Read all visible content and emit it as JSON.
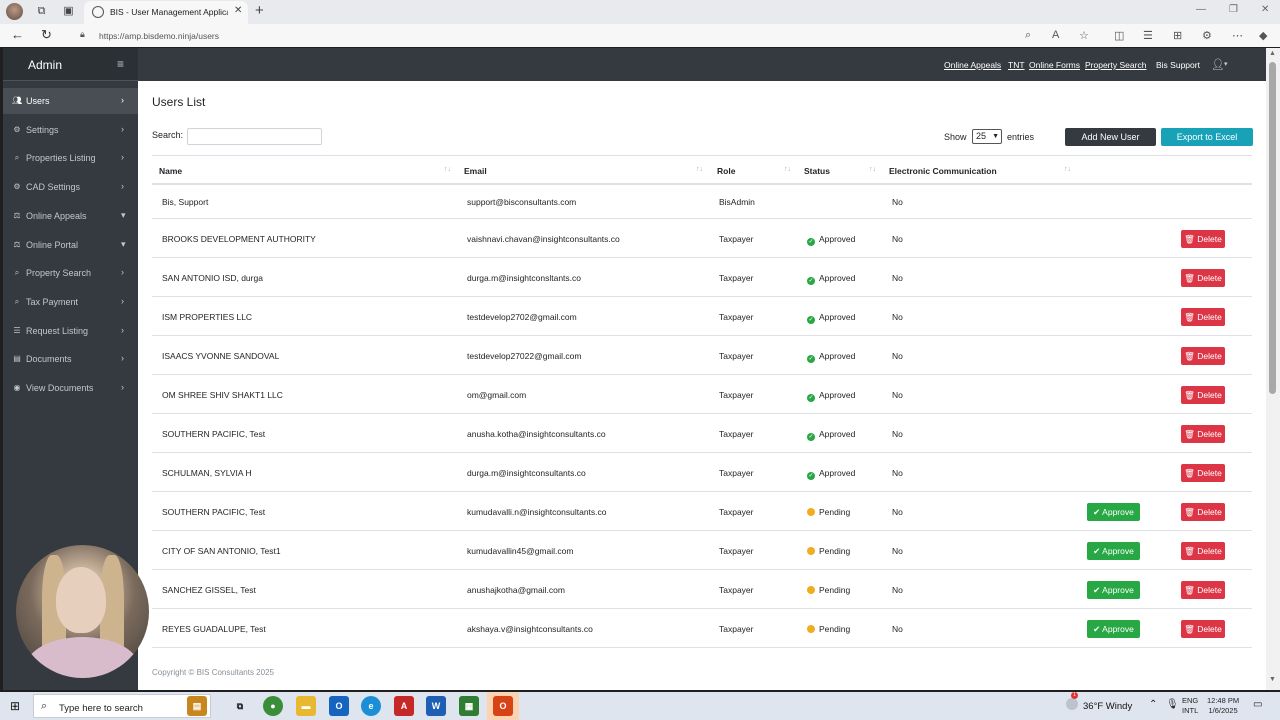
{
  "browser": {
    "tab_title": "BIS - User Management Applicati",
    "url": "https://amp.bisdemo.ninja/users"
  },
  "sidebar": {
    "brand": "Admin",
    "items": [
      {
        "label": "Users",
        "icon": "users-icon",
        "chevron": "›",
        "active": true
      },
      {
        "label": "Settings",
        "icon": "gear-icon",
        "chevron": "›"
      },
      {
        "label": "Properties Listing",
        "icon": "search-icon",
        "chevron": "›"
      },
      {
        "label": "CAD Settings",
        "icon": "gear-icon",
        "chevron": "›"
      },
      {
        "label": "Online Appeals",
        "icon": "gavel-icon",
        "chevron": "▾"
      },
      {
        "label": "Online Portal",
        "icon": "gavel-icon",
        "chevron": "▾"
      },
      {
        "label": "Property Search",
        "icon": "search-icon",
        "chevron": "›"
      },
      {
        "label": "Tax Payment",
        "icon": "search-icon",
        "chevron": "›"
      },
      {
        "label": "Request Listing",
        "icon": "list-icon",
        "chevron": "›"
      },
      {
        "label": "Documents",
        "icon": "file-icon",
        "chevron": "›"
      },
      {
        "label": "View Documents",
        "icon": "eye-icon",
        "chevron": "›"
      }
    ]
  },
  "topnav": {
    "links": [
      "Online Appeals",
      "TNT",
      "Online Forms",
      "Property Search"
    ],
    "user": "Bis Support"
  },
  "page": {
    "title": "Users List",
    "search_label": "Search:",
    "show_label": "Show",
    "page_size": "25",
    "entries_label": "entries",
    "add_button": "Add New User",
    "export_button": "Export to Excel",
    "footer": "Copyright © BIS Consultants 2025"
  },
  "table": {
    "columns": [
      "Name",
      "Email",
      "Role",
      "Status",
      "Electronic Communication"
    ],
    "delete_label": "Delete",
    "approve_label": "Approve",
    "rows": [
      {
        "name": "Bis, Support",
        "email": "support@bisconsultants.com",
        "role": "BisAdmin",
        "status": "",
        "ecomm": "No",
        "approve": false,
        "delete": false
      },
      {
        "name": "BROOKS DEVELOPMENT AUTHORITY",
        "email": "vaishnavi.chavan@insightconsultants.co",
        "role": "Taxpayer",
        "status": "Approved",
        "ecomm": "No",
        "approve": false,
        "delete": true
      },
      {
        "name": "SAN ANTONIO ISD, durga",
        "email": "durga.m@insightconsltants.co",
        "role": "Taxpayer",
        "status": "Approved",
        "ecomm": "No",
        "approve": false,
        "delete": true
      },
      {
        "name": "ISM PROPERTIES LLC",
        "email": "testdevelop2702@gmail.com",
        "role": "Taxpayer",
        "status": "Approved",
        "ecomm": "No",
        "approve": false,
        "delete": true
      },
      {
        "name": "ISAACS YVONNE SANDOVAL",
        "email": "testdevelop27022@gmail.com",
        "role": "Taxpayer",
        "status": "Approved",
        "ecomm": "No",
        "approve": false,
        "delete": true
      },
      {
        "name": "OM SHREE SHIV SHAKT1 LLC",
        "email": "om@gmail.com",
        "role": "Taxpayer",
        "status": "Approved",
        "ecomm": "No",
        "approve": false,
        "delete": true
      },
      {
        "name": "SOUTHERN PACIFIC, Test",
        "email": "anusha.kotha@insightconsultants.co",
        "role": "Taxpayer",
        "status": "Approved",
        "ecomm": "No",
        "approve": false,
        "delete": true
      },
      {
        "name": "SCHULMAN, SYLVIA H",
        "email": "durga.m@insightconsultants.co",
        "role": "Taxpayer",
        "status": "Approved",
        "ecomm": "No",
        "approve": false,
        "delete": true
      },
      {
        "name": "SOUTHERN PACIFIC, Test",
        "email": "kumudavalli.n@insightconsultants.co",
        "role": "Taxpayer",
        "status": "Pending",
        "ecomm": "No",
        "approve": true,
        "delete": true
      },
      {
        "name": "CITY OF SAN ANTONIO, Test1",
        "email": "kumudavallin45@gmail.com",
        "role": "Taxpayer",
        "status": "Pending",
        "ecomm": "No",
        "approve": true,
        "delete": true
      },
      {
        "name": "SANCHEZ GISSEL, Test",
        "email": "anushajkotha@gmail.com",
        "role": "Taxpayer",
        "status": "Pending",
        "ecomm": "No",
        "approve": true,
        "delete": true
      },
      {
        "name": "REYES GUADALUPE, Test",
        "email": "akshaya.v@insightconsultants.co",
        "role": "Taxpayer",
        "status": "Pending",
        "ecomm": "No",
        "approve": true,
        "delete": true
      }
    ]
  },
  "taskbar": {
    "search_placeholder": "Type here to search",
    "weather": "36°F  Windy",
    "lang1": "ENG",
    "lang2": "INTL",
    "time": "12:48 PM",
    "date": "1/6/2025",
    "weather_badge": "1"
  },
  "colors": {
    "sidebar": "#343a40",
    "danger": "#dc3545",
    "success": "#28a745",
    "info": "#17a2b8",
    "pending": "#f0ad1e"
  }
}
